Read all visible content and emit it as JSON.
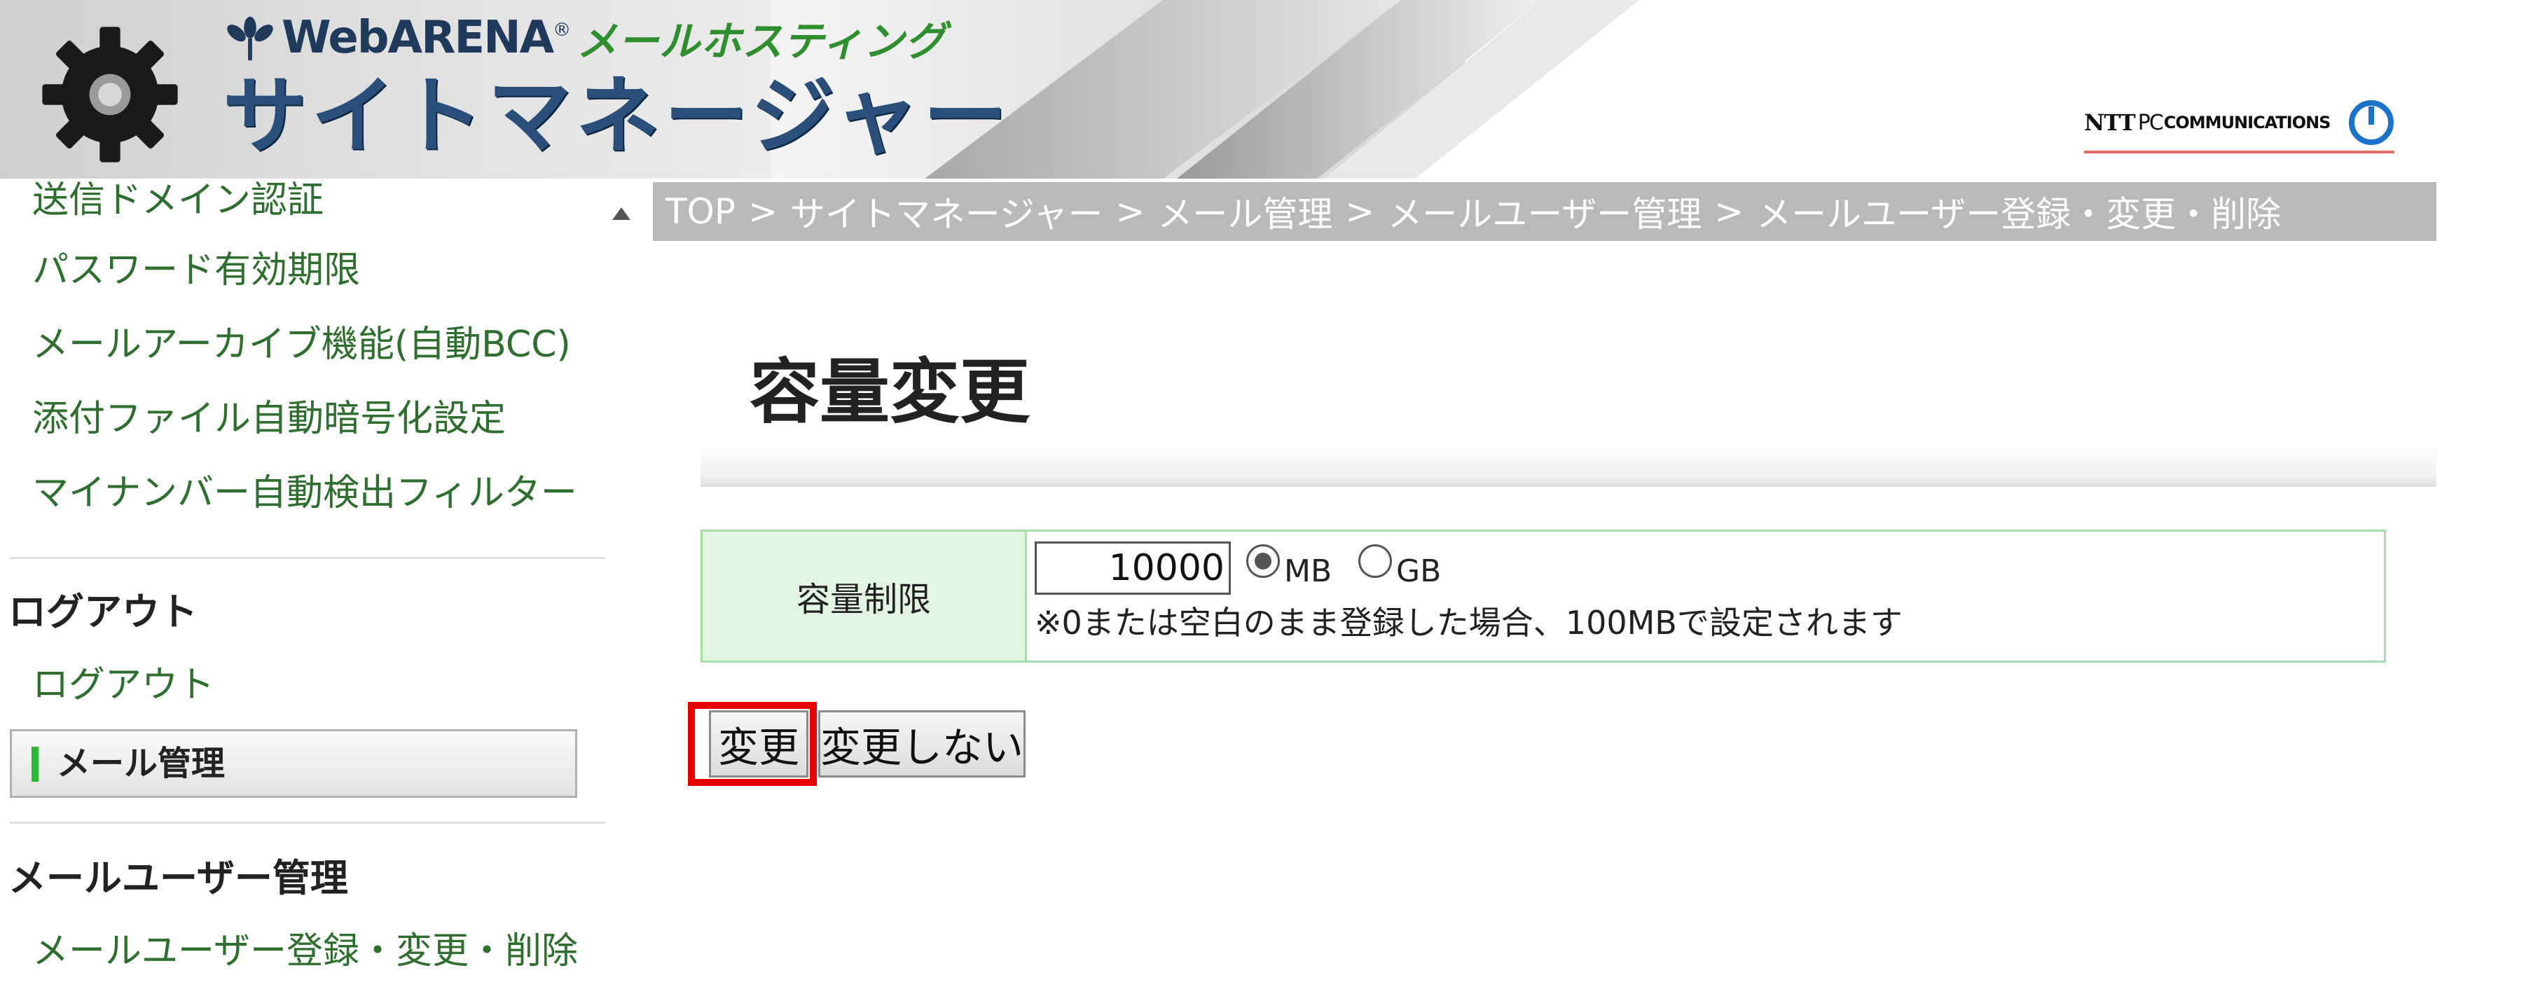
{
  "header": {
    "brand_name": "WebARENA",
    "brand_tm": "®",
    "brand_product": "メールホスティング",
    "site_title": "サイトマネージャー",
    "ntt_text": "NTT",
    "ntt_pc": "PC",
    "ntt_comm": "COMMUNICATIONS"
  },
  "sidebar": {
    "links_top": [
      {
        "label": "送信ドメイン認証"
      },
      {
        "label": "パスワード有効期限"
      },
      {
        "label": "メールアーカイブ機能(自動BCC)"
      },
      {
        "label": "添付ファイル自動暗号化設定"
      },
      {
        "label": "マイナンバー自動検出フィルター"
      }
    ],
    "logout_heading": "ログアウト",
    "logout_link": "ログアウト",
    "active_section": "メール管理",
    "user_heading": "メールユーザー管理",
    "user_link": "メールユーザー登録・変更・削除"
  },
  "breadcrumb": {
    "items": [
      "TOP",
      "サイトマネージャー",
      "メール管理",
      "メールユーザー管理",
      "メールユーザー登録・変更・削除"
    ],
    "separator": ">"
  },
  "main": {
    "title": "容量変更",
    "form": {
      "label": "容量制限",
      "value": "10000",
      "unit_options": [
        {
          "label": "MB",
          "selected": true
        },
        {
          "label": "GB",
          "selected": false
        }
      ],
      "note": "※0または空白のまま登録した場合、100MBで設定されます"
    },
    "buttons": {
      "change": "変更",
      "no_change": "変更しない"
    }
  },
  "colors": {
    "sidebar_link": "#2e6e2e",
    "breadcrumb_bg": "#b9b9b9",
    "form_border": "#a8dca8",
    "form_label_bg": "#e2f5e2",
    "highlight": "#e60000",
    "active_marker": "#2db82d"
  },
  "icons": {
    "logo": "gear-icon",
    "brand": "flower-icon",
    "ntt": "ntt-power-icon",
    "scroll": "scroll-up-icon"
  }
}
